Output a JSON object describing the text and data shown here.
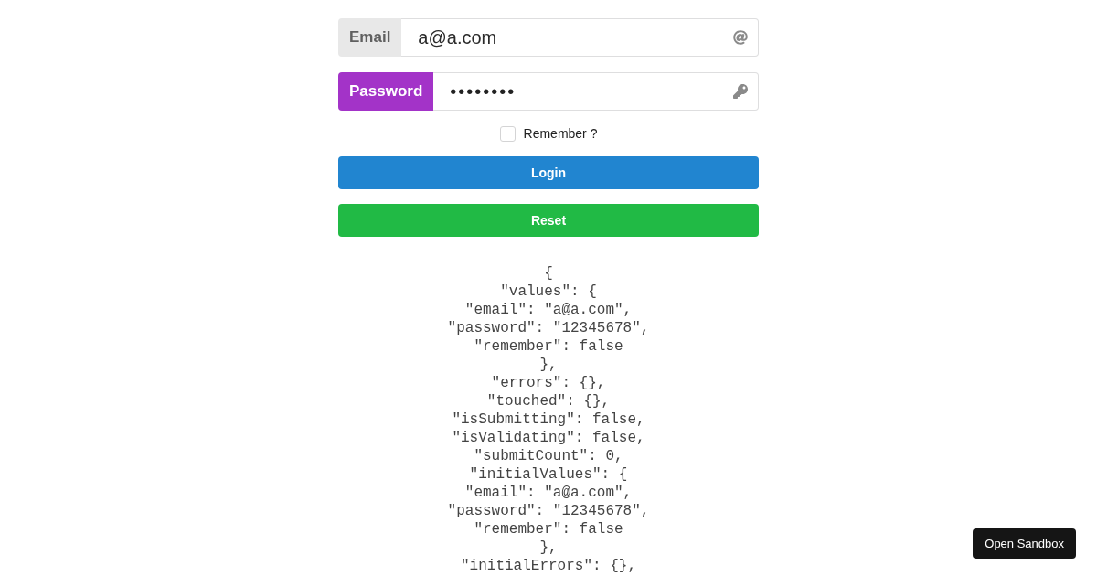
{
  "form": {
    "fields": [
      {
        "kind": "email",
        "label": "Email",
        "value": "a@a.com"
      },
      {
        "kind": "password",
        "label": "Password",
        "value": "••••••••"
      }
    ],
    "remember": {
      "label": "Remember ?",
      "checked": false
    },
    "buttons": [
      {
        "kind": "primary",
        "label": "Login"
      },
      {
        "kind": "positive",
        "label": "Reset"
      }
    ]
  },
  "state_dump": {
    "lines": [
      "{",
      "\"values\": {",
      "\"email\": \"a@a.com\",",
      "\"password\": \"12345678\",",
      "\"remember\": false",
      "},",
      "\"errors\": {},",
      "\"touched\": {},",
      "\"isSubmitting\": false,",
      "\"isValidating\": false,",
      "\"submitCount\": 0,",
      "\"initialValues\": {",
      "\"email\": \"a@a.com\",",
      "\"password\": \"12345678\",",
      "\"remember\": false",
      "},",
      "\"initialErrors\": {},"
    ]
  },
  "sandbox_button": {
    "label": "Open Sandbox"
  }
}
